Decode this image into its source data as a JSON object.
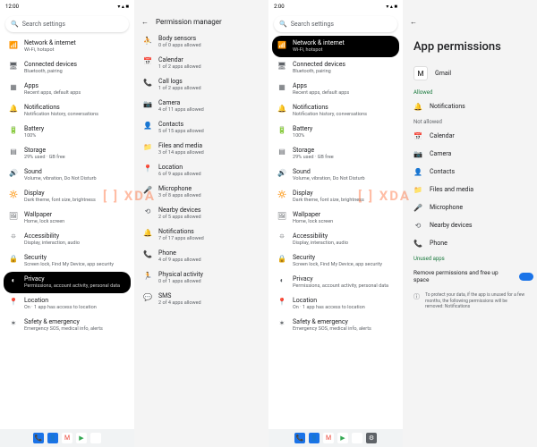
{
  "watermark": "[ ] XDA",
  "panel1": {
    "time": "12:00",
    "search_placeholder": "Search settings",
    "items": [
      {
        "icon": "wifi",
        "title": "Network & internet",
        "sub": "Wi-Fi, hotspot"
      },
      {
        "icon": "devices",
        "title": "Connected devices",
        "sub": "Bluetooth, pairing"
      },
      {
        "icon": "apps",
        "title": "Apps",
        "sub": "Recent apps, default apps"
      },
      {
        "icon": "bell",
        "title": "Notifications",
        "sub": "Notification history, conversations"
      },
      {
        "icon": "battery",
        "title": "Battery",
        "sub": "100%"
      },
      {
        "icon": "storage",
        "title": "Storage",
        "sub": "29% used · GB free"
      },
      {
        "icon": "sound",
        "title": "Sound",
        "sub": "Volume, vibration, Do Not Disturb"
      },
      {
        "icon": "display",
        "title": "Display",
        "sub": "Dark theme, font size, brightness"
      },
      {
        "icon": "wallpaper",
        "title": "Wallpaper",
        "sub": "Home, lock screen"
      },
      {
        "icon": "a11y",
        "title": "Accessibility",
        "sub": "Display, interaction, audio"
      },
      {
        "icon": "lock",
        "title": "Security",
        "sub": "Screen lock, Find My Device, app security"
      },
      {
        "icon": "privacy",
        "title": "Privacy",
        "sub": "Permissions, account activity, personal data",
        "selected": true
      },
      {
        "icon": "location",
        "title": "Location",
        "sub": "On · 1 app has access to location"
      },
      {
        "icon": "safety",
        "title": "Safety & emergency",
        "sub": "Emergency SOS, medical info, alerts"
      }
    ]
  },
  "panel2": {
    "title": "Permission manager",
    "items": [
      {
        "icon": "body",
        "title": "Body sensors",
        "sub": "0 of 0 apps allowed"
      },
      {
        "icon": "calendar",
        "title": "Calendar",
        "sub": "1 of 2 apps allowed"
      },
      {
        "icon": "phone",
        "title": "Call logs",
        "sub": "1 of 2 apps allowed"
      },
      {
        "icon": "camera",
        "title": "Camera",
        "sub": "4 of 11 apps allowed"
      },
      {
        "icon": "contacts",
        "title": "Contacts",
        "sub": "5 of 15 apps allowed"
      },
      {
        "icon": "folder",
        "title": "Files and media",
        "sub": "3 of 14 apps allowed"
      },
      {
        "icon": "location",
        "title": "Location",
        "sub": "6 of 9 apps allowed"
      },
      {
        "icon": "mic",
        "title": "Microphone",
        "sub": "3 of 8 apps allowed"
      },
      {
        "icon": "nearby",
        "title": "Nearby devices",
        "sub": "2 of 5 apps allowed"
      },
      {
        "icon": "bell",
        "title": "Notifications",
        "sub": "7 of 17 apps allowed"
      },
      {
        "icon": "phone",
        "title": "Phone",
        "sub": "4 of 9 apps allowed"
      },
      {
        "icon": "run",
        "title": "Physical activity",
        "sub": "0 of 1 apps allowed"
      },
      {
        "icon": "sms",
        "title": "SMS",
        "sub": "2 of 4 apps allowed"
      }
    ]
  },
  "panel3": {
    "time": "2:00",
    "search_placeholder": "Search settings",
    "items": [
      {
        "icon": "wifi",
        "title": "Network & internet",
        "sub": "Wi-Fi, hotspot",
        "selected": true
      },
      {
        "icon": "devices",
        "title": "Connected devices",
        "sub": "Bluetooth, pairing"
      },
      {
        "icon": "apps",
        "title": "Apps",
        "sub": "Recent apps, default apps"
      },
      {
        "icon": "bell",
        "title": "Notifications",
        "sub": "Notification history, conversations"
      },
      {
        "icon": "battery",
        "title": "Battery",
        "sub": "100%"
      },
      {
        "icon": "storage",
        "title": "Storage",
        "sub": "29% used · GB free"
      },
      {
        "icon": "sound",
        "title": "Sound",
        "sub": "Volume, vibration, Do Not Disturb"
      },
      {
        "icon": "display",
        "title": "Display",
        "sub": "Dark theme, font size, brightness"
      },
      {
        "icon": "wallpaper",
        "title": "Wallpaper",
        "sub": "Home, lock screen"
      },
      {
        "icon": "a11y",
        "title": "Accessibility",
        "sub": "Display, interaction, audio"
      },
      {
        "icon": "lock",
        "title": "Security",
        "sub": "Screen lock, Find My Device, app security"
      },
      {
        "icon": "privacy",
        "title": "Privacy",
        "sub": "Permissions, account activity, personal data"
      },
      {
        "icon": "location",
        "title": "Location",
        "sub": "On · 1 app has access to location"
      },
      {
        "icon": "safety",
        "title": "Safety & emergency",
        "sub": "Emergency SOS, medical info, alerts"
      }
    ]
  },
  "panel4": {
    "header": "App permissions",
    "app_name": "Gmail",
    "allowed_label": "Allowed",
    "notallowed_label": "Not allowed",
    "unused_label": "Unused apps",
    "allowed": [
      {
        "icon": "bell",
        "label": "Notifications"
      }
    ],
    "notallowed": [
      {
        "icon": "calendar",
        "label": "Calendar"
      },
      {
        "icon": "camera",
        "label": "Camera"
      },
      {
        "icon": "contacts",
        "label": "Contacts"
      },
      {
        "icon": "folder",
        "label": "Files and media"
      },
      {
        "icon": "mic",
        "label": "Microphone"
      },
      {
        "icon": "nearby",
        "label": "Nearby devices"
      },
      {
        "icon": "phone",
        "label": "Phone"
      }
    ],
    "remove_text": "Remove permissions and free up space",
    "protect_text": "To protect your data, if the app is unused for a few months, the following permissions will be removed: Notifications"
  },
  "taskbar_apps": [
    "phone",
    "contact",
    "gmail",
    "play",
    "photos",
    "settings"
  ]
}
